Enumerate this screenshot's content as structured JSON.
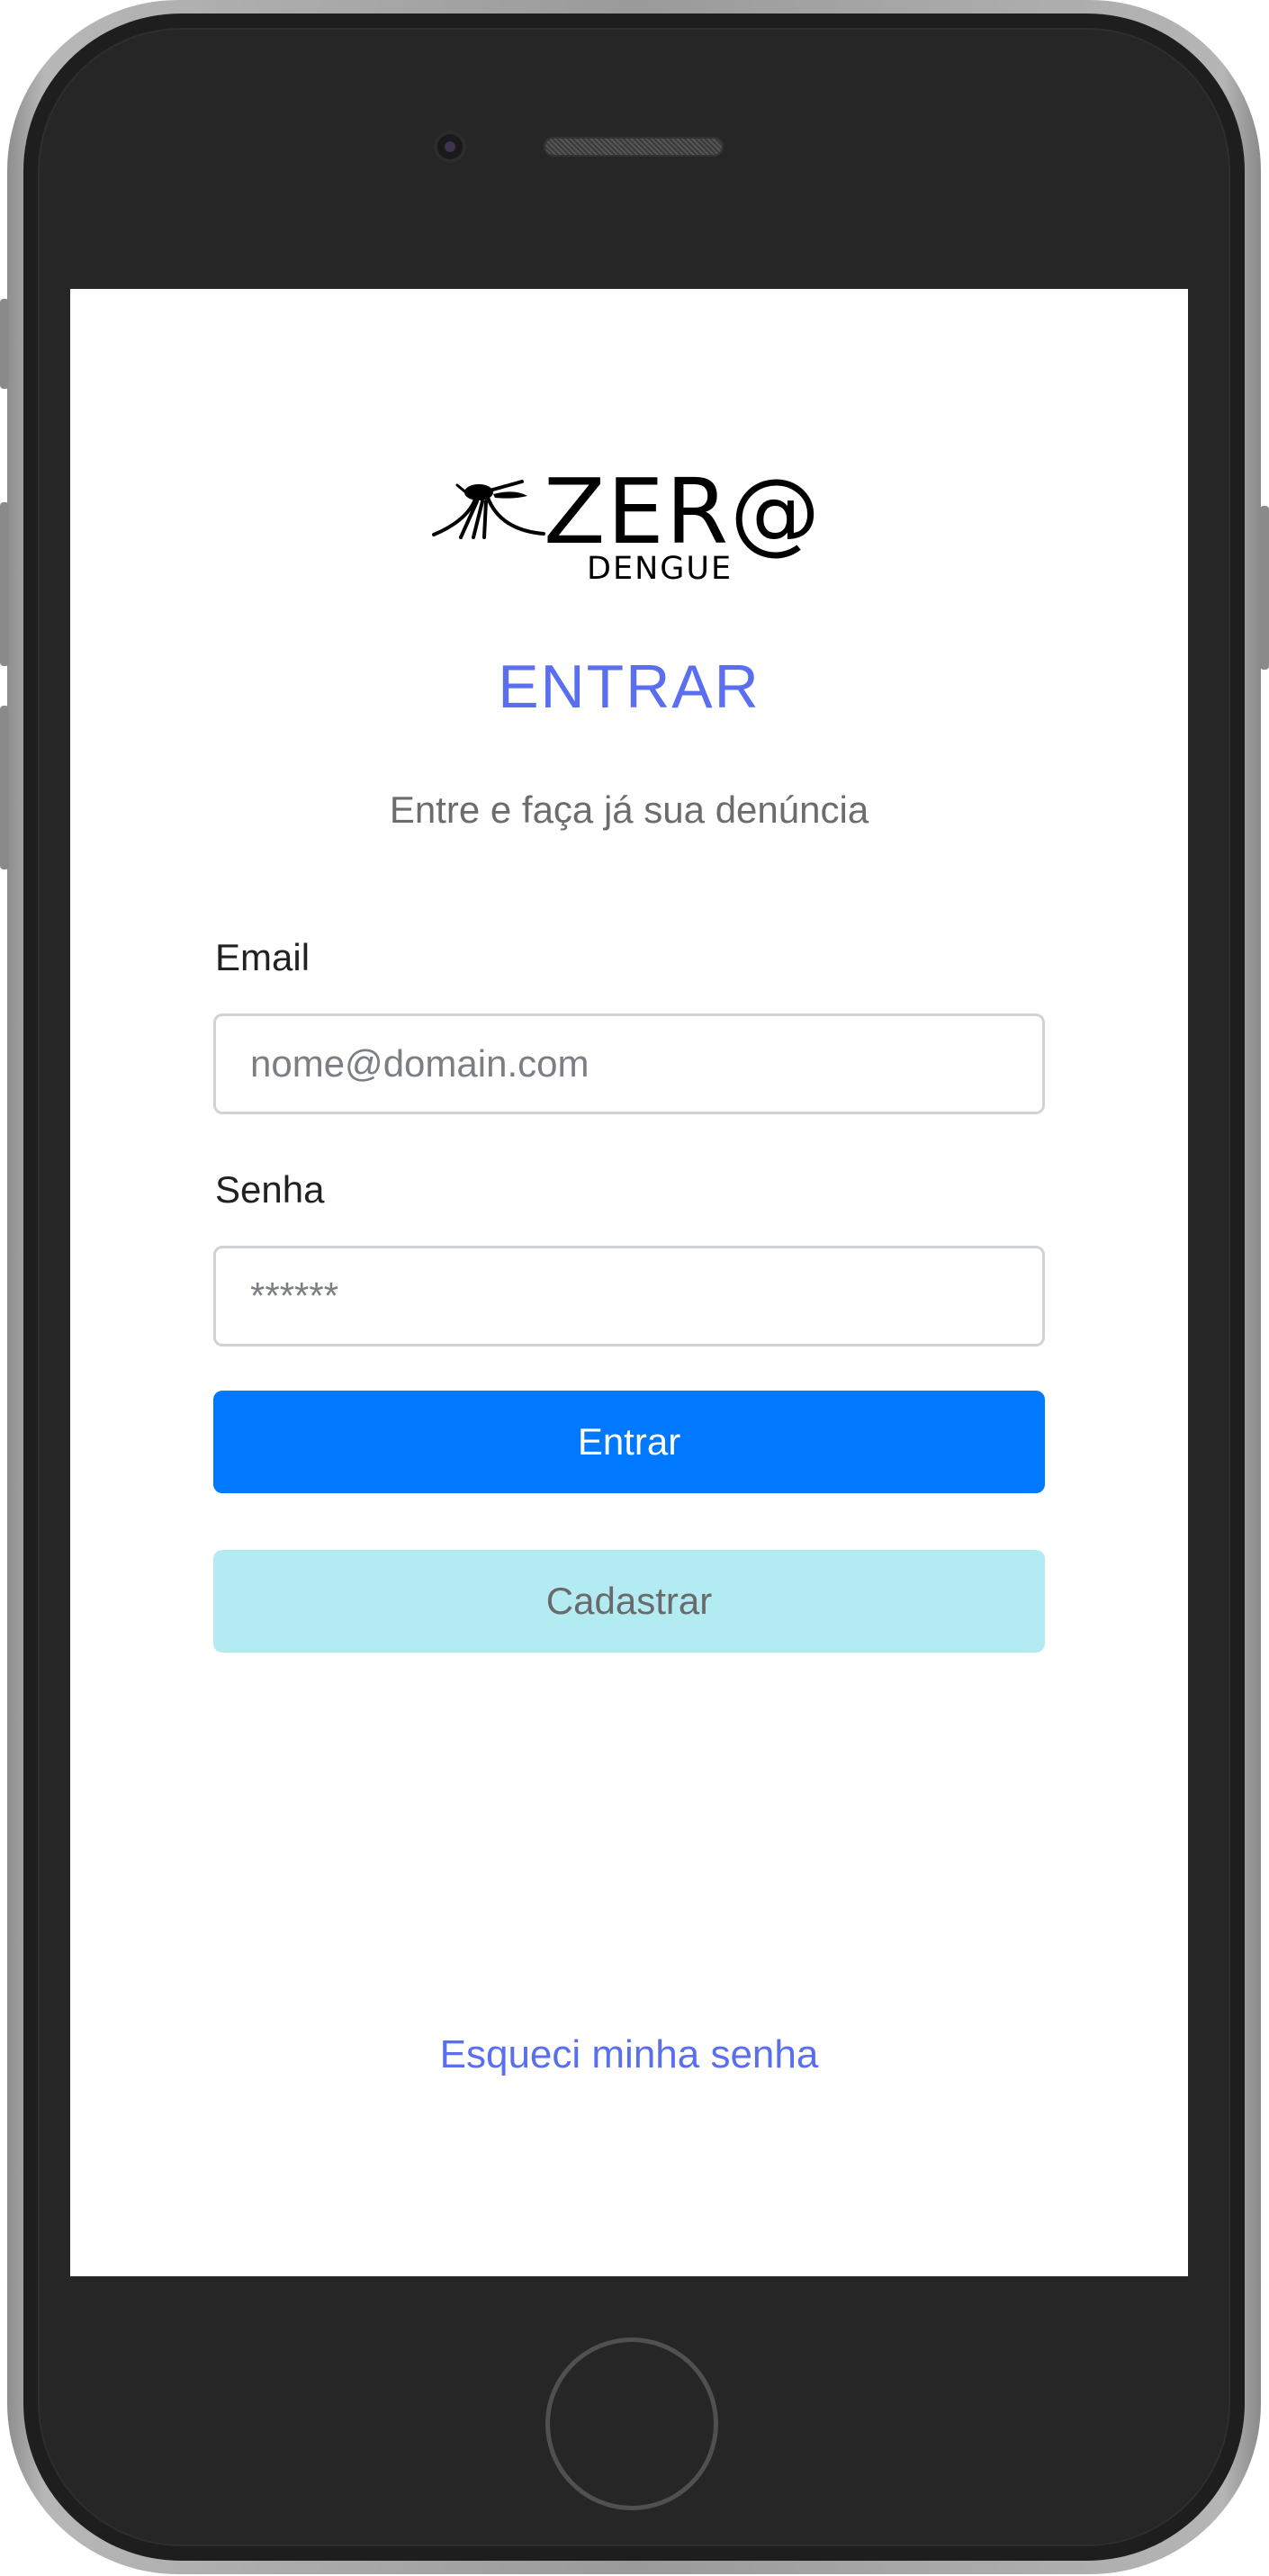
{
  "logo": {
    "word": "ZER@",
    "sub": "DENGUE"
  },
  "page": {
    "title": "ENTRAR",
    "subtitle": "Entre e faça já sua denúncia"
  },
  "form": {
    "email_label": "Email",
    "email_placeholder": "nome@domain.com",
    "password_label": "Senha",
    "password_placeholder": "******",
    "login_button": "Entrar",
    "register_button": "Cadastrar",
    "forgot_link": "Esqueci minha senha"
  },
  "colors": {
    "accent": "#5a6ff0",
    "primary_button": "#0079ff",
    "secondary_button": "#b3ebf2"
  }
}
